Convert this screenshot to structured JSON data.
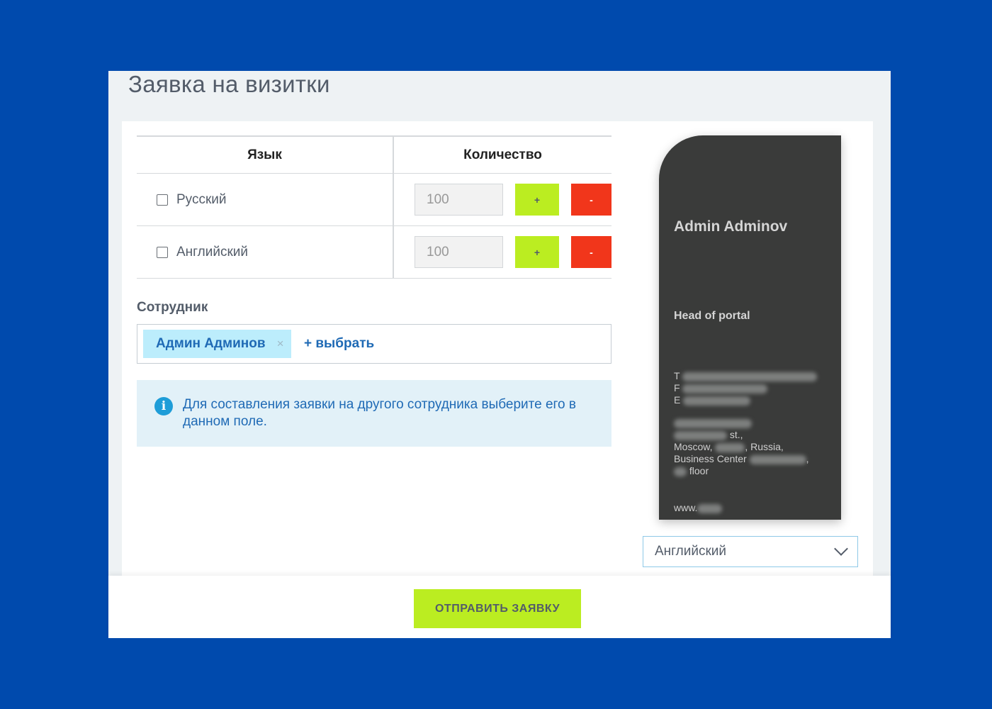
{
  "page": {
    "title": "Заявка на визитки"
  },
  "table": {
    "headers": {
      "language": "Язык",
      "quantity": "Количество"
    },
    "rows": [
      {
        "language": "Русский",
        "quantity": "100",
        "plus": "+",
        "minus": "-"
      },
      {
        "language": "Английский",
        "quantity": "100",
        "plus": "+",
        "minus": "-"
      }
    ]
  },
  "employee": {
    "label": "Сотрудник",
    "selected": "Админ Админов",
    "remove": "×",
    "choose": "+ выбрать"
  },
  "info": {
    "icon": "i",
    "text": "Для составления заявки на другого сотрудника выберите его в данном поле."
  },
  "card": {
    "name": "Admin Adminov",
    "position": "Head of portal",
    "phone_label": "T",
    "fax_label": "F",
    "email_label": "E",
    "address_street": "st.,",
    "address_city": "Moscow,",
    "address_country": ", Russia,",
    "address_bc": "Business Center",
    "address_comma": ",",
    "address_floor": "floor",
    "web": "www."
  },
  "language_select": {
    "value": "Английский"
  },
  "footer": {
    "submit": "ОТПРАВИТЬ ЗАЯВКУ"
  },
  "colors": {
    "background": "#004aad",
    "accent_green": "#bbed21",
    "accent_red": "#f1361b",
    "link": "#1f6ab5"
  }
}
